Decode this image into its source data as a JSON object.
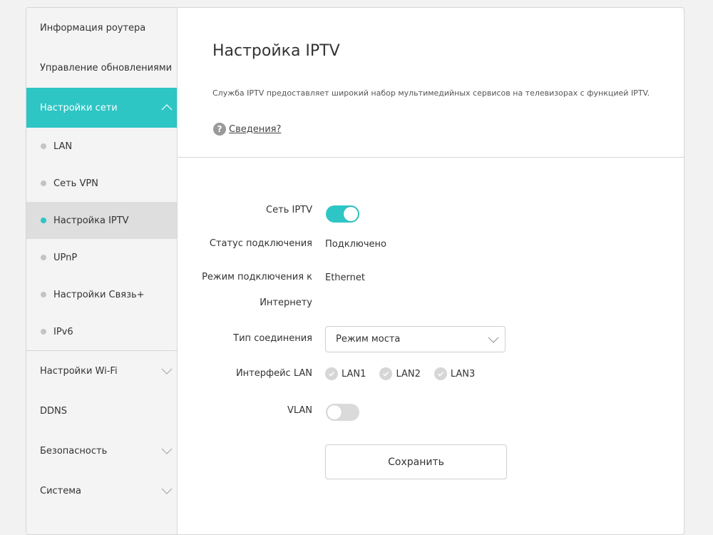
{
  "sidebar": {
    "items_top": [
      {
        "label": "Информация роутера"
      },
      {
        "label": "Управление обновлениями"
      }
    ],
    "network": {
      "label": "Настройки сети",
      "subitems": [
        {
          "label": "LAN"
        },
        {
          "label": "Сеть VPN"
        },
        {
          "label": "Настройка IPTV"
        },
        {
          "label": "UPnP"
        },
        {
          "label": "Настройки Связь+"
        },
        {
          "label": "IPv6"
        }
      ]
    },
    "items_bottom": [
      {
        "label": "Настройки Wi-Fi"
      },
      {
        "label": "DDNS"
      },
      {
        "label": "Безопасность"
      },
      {
        "label": "Система"
      }
    ]
  },
  "header": {
    "title": "Настройка IPTV",
    "description": "Служба IPTV предоставляет широкий набор мультимедийных сервисов на телевизорах с функцией IPTV.",
    "info_icon": "?",
    "info_link": "Сведения?"
  },
  "form": {
    "iptv_label": "Сеть IPTV",
    "iptv_enabled": true,
    "status_label": "Статус подключения",
    "status_value": "Подключено",
    "mode_label_1": "Режим подключения к",
    "mode_label_2": "Интернету",
    "mode_value": "Ethernet",
    "type_label": "Тип соединения",
    "type_value": "Режим моста",
    "lan_label": "Интерфейс LAN",
    "lan_options": [
      {
        "label": "LAN1"
      },
      {
        "label": "LAN2"
      },
      {
        "label": "LAN3"
      }
    ],
    "vlan_label": "VLAN",
    "vlan_enabled": false,
    "save_label": "Сохранить"
  },
  "colors": {
    "accent": "#2ec5c5"
  }
}
